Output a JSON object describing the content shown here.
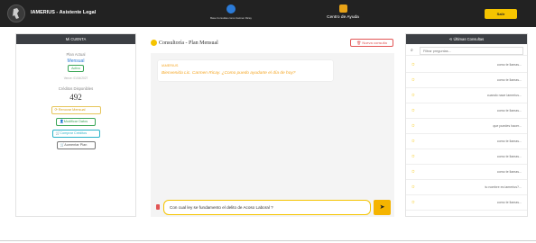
{
  "app": {
    "title": "IAMERIUS - Asistente Legal",
    "center_tag": "Base Consultas como Carmen Ricay",
    "help_label": "Centro de Ayuda",
    "exit_label": "Salir"
  },
  "sidebar": {
    "header": "Mi CUENTA",
    "plan_label": "Plan Actual",
    "plan_name": "Mensual",
    "plan_status": "Activo",
    "renewal": "Vence: 01/04/2027",
    "credits_label": "Créditos Disponibles",
    "credits_value": "492",
    "buttons": [
      {
        "label": "Renovar Mensual",
        "icon": "refresh-icon"
      },
      {
        "label": "Modificar Datos",
        "icon": "user-icon"
      },
      {
        "label": "Comprar Créditos",
        "icon": "cart-icon"
      },
      {
        "label": "Aumentar Plan",
        "icon": "cart-icon"
      }
    ]
  },
  "chat": {
    "title": "Consultoría - Plan Mensual",
    "new_button": "Nueva consulta",
    "bot_name": "IAMERIUS",
    "welcome": "Bienvenida Lic. Carmen Ricay. ¿Como puedo ayudarte el día de hoy?",
    "input_value": "Con cual ley se fundamento el delito de Acoso Laboral ?"
  },
  "history": {
    "header": "Últimas Consultas",
    "filter_placeholder": "Filtrar preguntas...",
    "items": [
      "como te llamas...",
      "como te llamas...",
      "cuando nace iamerius...",
      "como te llamas...",
      "que puedes hacer...",
      "como te llamas...",
      "como te llamas...",
      "como te llamas...",
      "tu nombre es iamerius?...",
      "como te llamas..."
    ]
  },
  "colors": {
    "accent": "#f5c400",
    "dark": "#222222",
    "green": "#3aa657",
    "blue": "#2b7bd8",
    "red": "#e25555"
  }
}
